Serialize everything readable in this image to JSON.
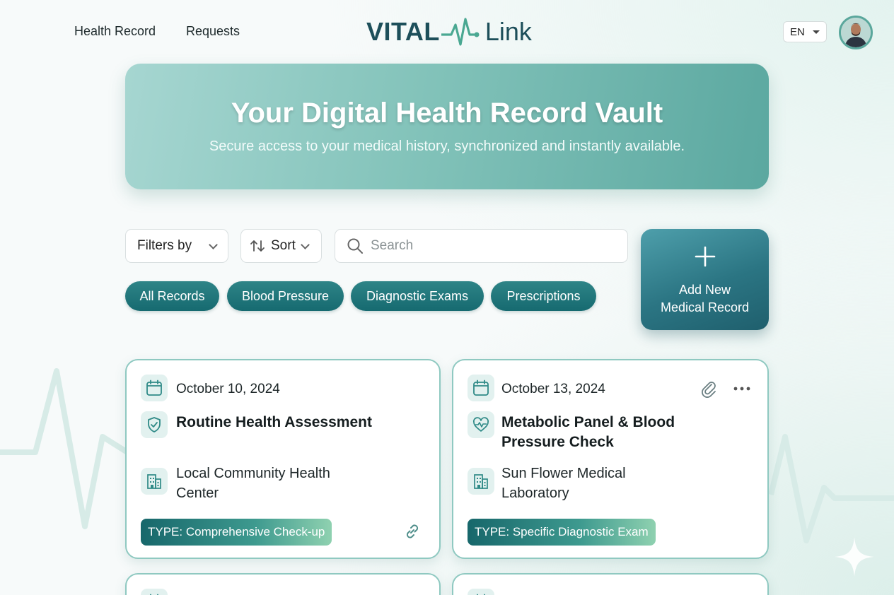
{
  "nav": {
    "links": [
      {
        "label": "Health Record"
      },
      {
        "label": "Requests"
      }
    ],
    "logo_part1": "VITAL",
    "logo_part2": "Link",
    "language": "EN",
    "brand_color": "#1d4f5a"
  },
  "hero": {
    "title": "Your Digital Health Record Vault",
    "subtitle": "Secure access to your medical history, synchronized and instantly available."
  },
  "controls": {
    "filter_label": "Filters by",
    "sort_label": "Sort",
    "search_placeholder": "Search",
    "add_button_line1": "Add New",
    "add_button_line2": "Medical Record"
  },
  "chips": [
    {
      "label": "All Records"
    },
    {
      "label": "Blood Pressure"
    },
    {
      "label": "Diagnostic Exams"
    },
    {
      "label": "Prescriptions"
    }
  ],
  "records": [
    {
      "date": "October 10, 2024",
      "title": "Routine Health Assessment",
      "facility_line1": "Local Community Health",
      "facility_line2": "Center",
      "type": "TYPE: Comprehensive Check-up",
      "title_icon": "shield-check-icon",
      "corner_icons": [
        "link-icon"
      ]
    },
    {
      "date": "October 13, 2024",
      "title_line1": "Metabolic Panel & Blood",
      "title_line2": "Pressure Check",
      "facility_line1": "Sun Flower Medical",
      "facility_line2": "Laboratory",
      "type": "TYPE: Specific Diagnostic Exam",
      "title_icon": "heart-pulse-icon",
      "corner_icons": [
        "paperclip-icon",
        "more-icon"
      ]
    }
  ],
  "colors": {
    "accent": "#166a70",
    "card_border": "#8fc9c1"
  }
}
